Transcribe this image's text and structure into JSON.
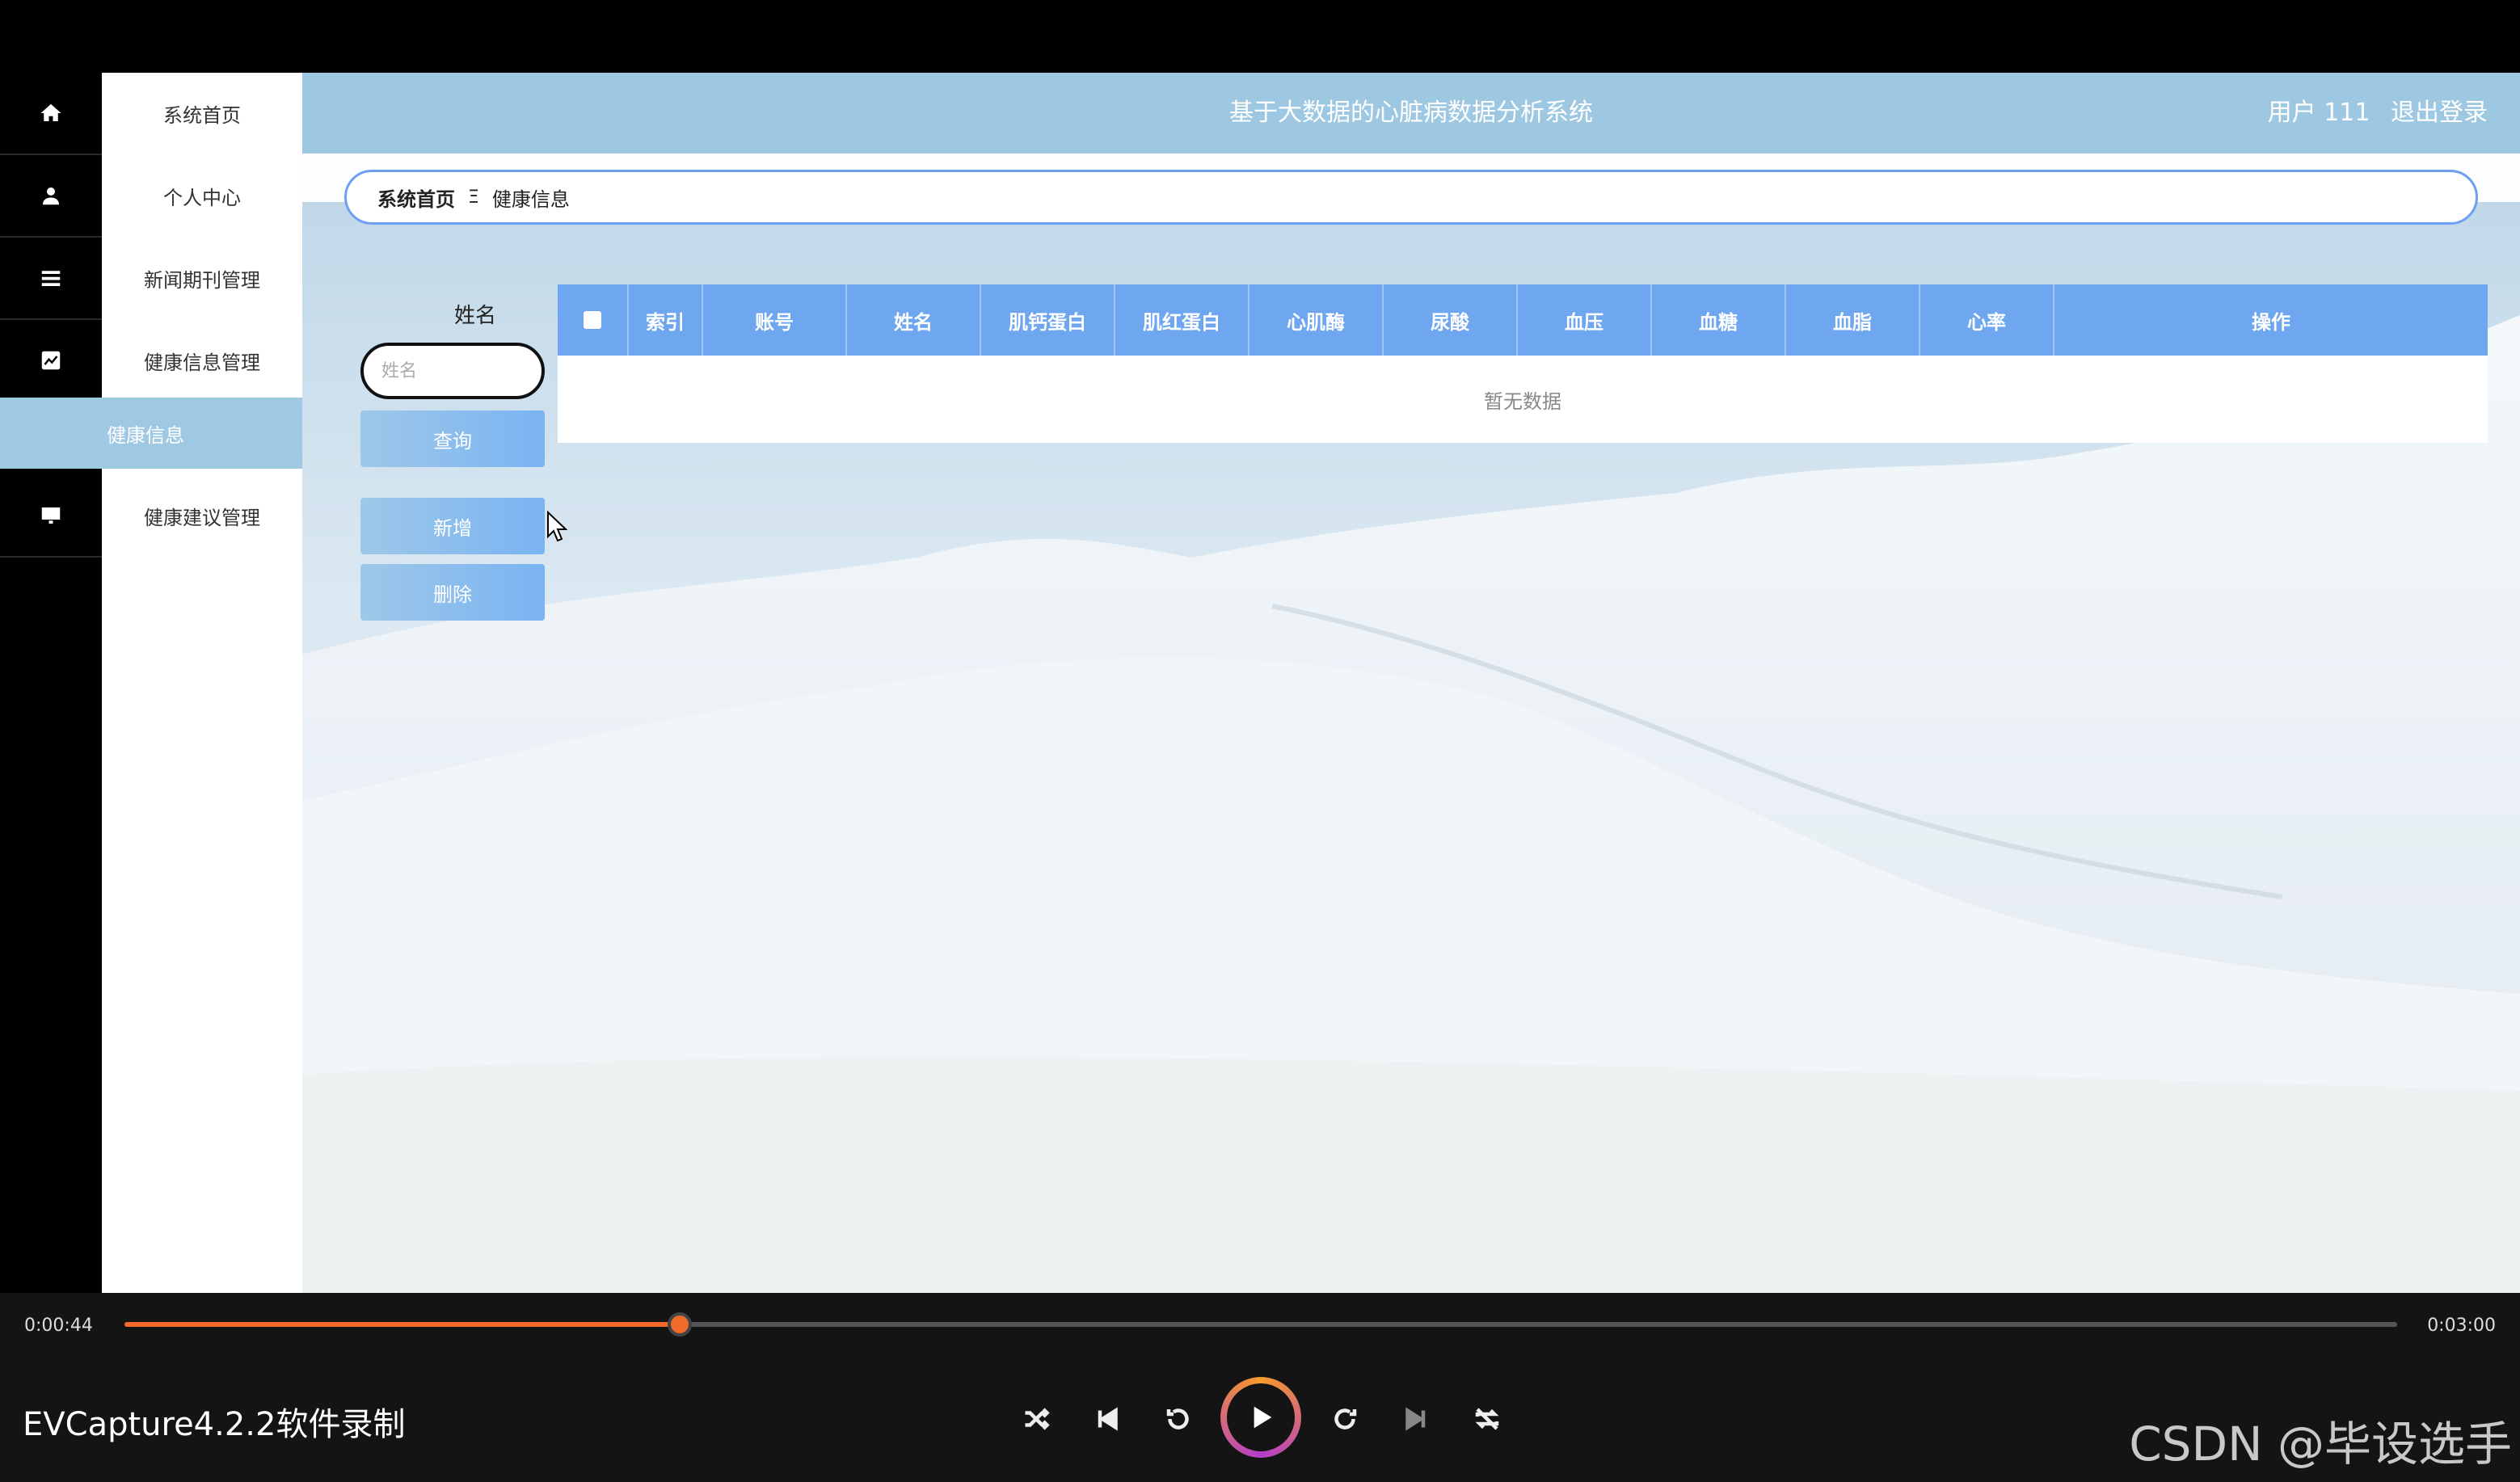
{
  "sidebar": {
    "items": [
      {
        "label": "系统首页",
        "icon": "home-icon"
      },
      {
        "label": "个人中心",
        "icon": "user-icon"
      },
      {
        "label": "新闻期刊管理",
        "icon": "list-icon"
      },
      {
        "label": "健康信息管理",
        "icon": "chart-icon"
      },
      {
        "label": "健康信息",
        "icon": ""
      },
      {
        "label": "健康建议管理",
        "icon": "monitor-icon"
      }
    ]
  },
  "header": {
    "title": "基于大数据的心脏病数据分析系统",
    "user": "用户 111",
    "logout": "退出登录"
  },
  "breadcrumb": {
    "home": "系统首页",
    "separator": "Ξ",
    "current": "健康信息"
  },
  "filter": {
    "name_label": "姓名",
    "name_placeholder": "姓名",
    "query_label": "查询",
    "add_label": "新增",
    "delete_label": "删除"
  },
  "table": {
    "columns": [
      "索引",
      "账号",
      "姓名",
      "肌钙蛋白",
      "肌红蛋白",
      "心肌酶",
      "尿酸",
      "血压",
      "血糖",
      "血脂",
      "心率",
      "操作"
    ],
    "empty_text": "暂无数据"
  },
  "player": {
    "current_time": "0:00:44",
    "total_time": "0:03:00",
    "progress": 0.2444,
    "recorder_label": "EVCapture4.2.2软件录制",
    "accent_color": "#f26b2b"
  },
  "watermark": "CSDN @毕设选手",
  "colors": {
    "header": "#9ec8e2",
    "table_header": "#6ea6f0",
    "active_menu": "#9fc9e3"
  }
}
